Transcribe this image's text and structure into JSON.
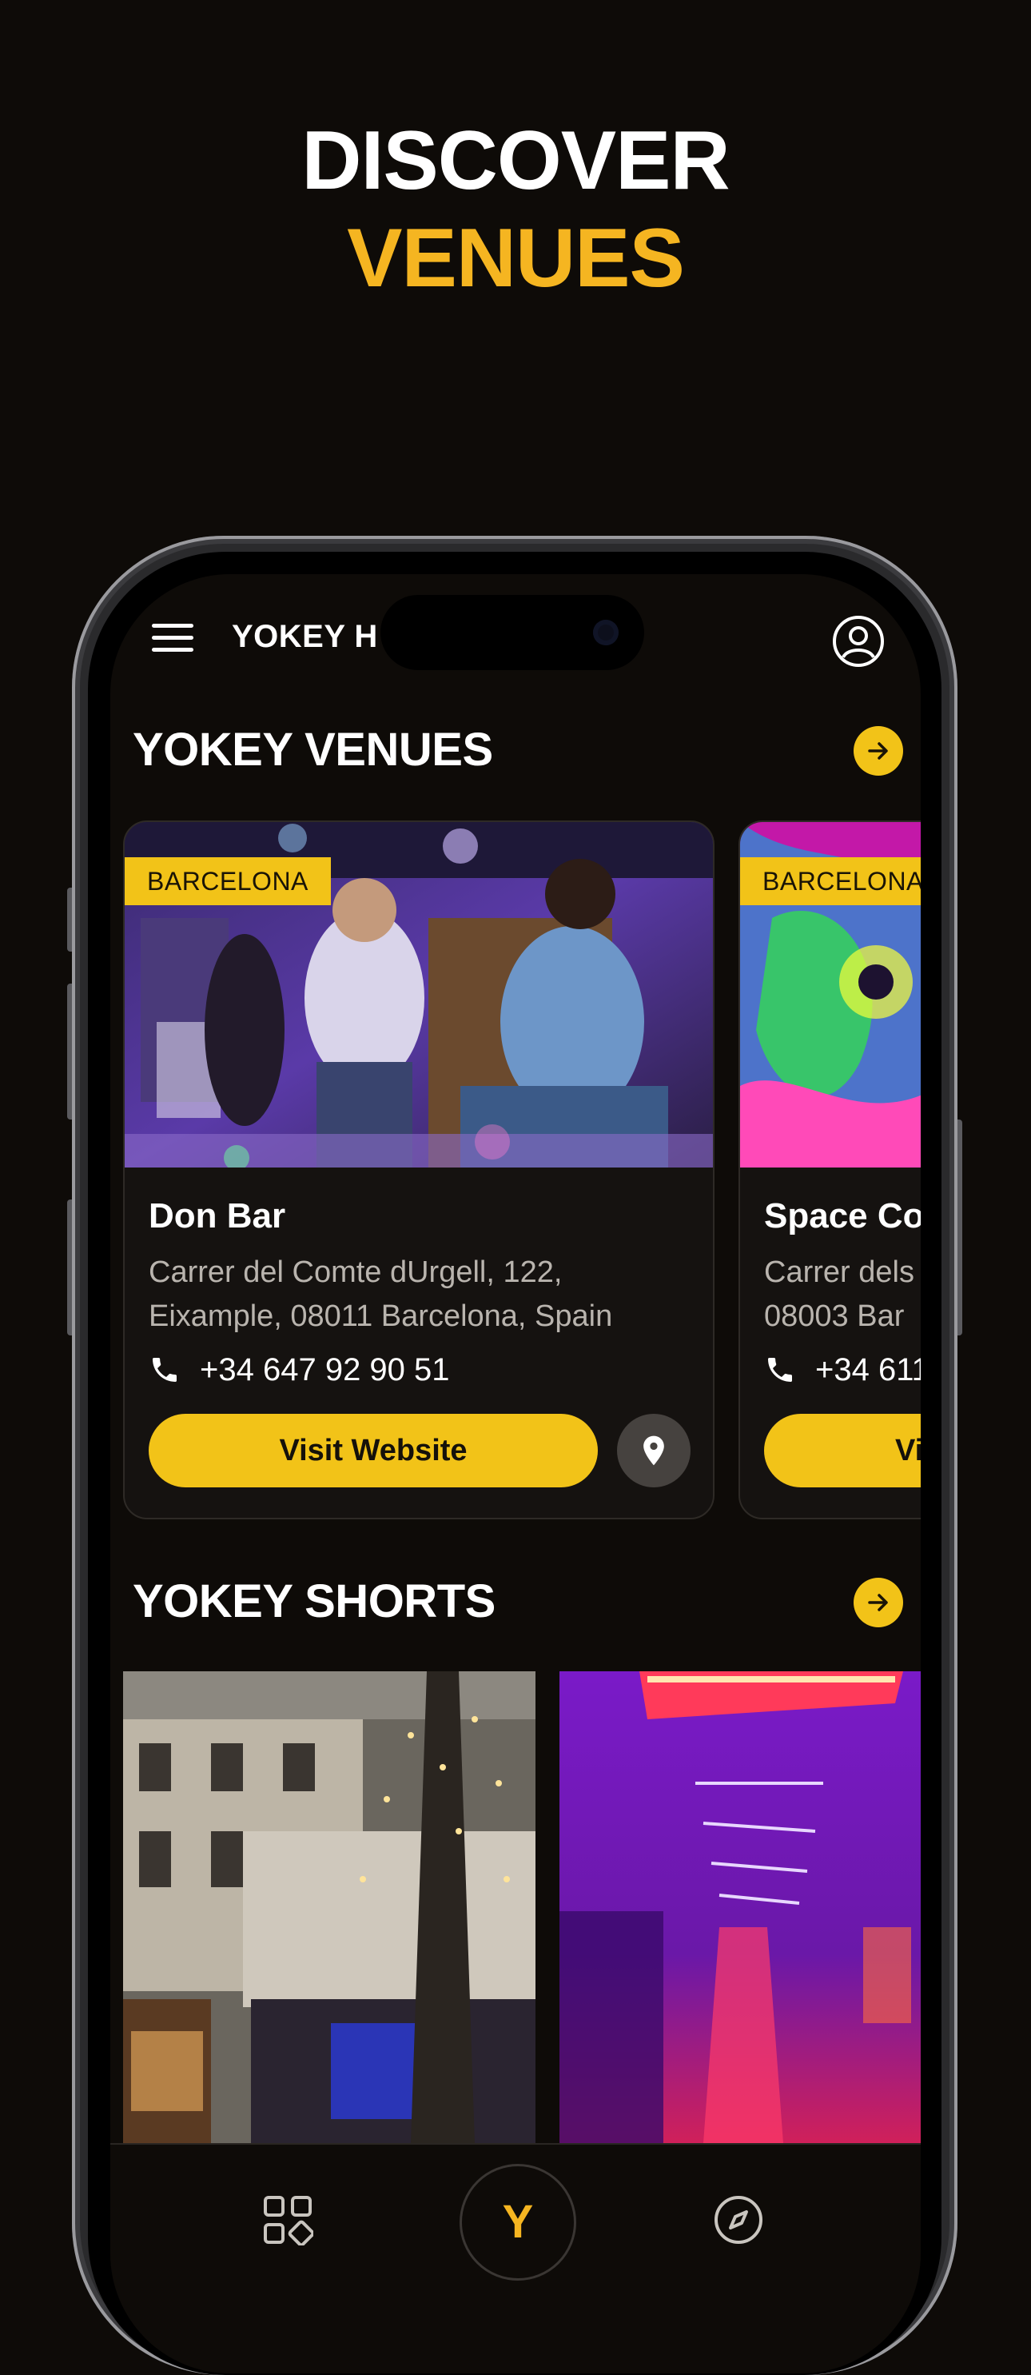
{
  "hero": {
    "line1": "DISCOVER",
    "line2": "VENUES"
  },
  "app": {
    "title": "YOKEY H",
    "menu_icon": "hamburger-menu-icon",
    "profile_icon": "user-circle-icon"
  },
  "sections": {
    "venues_title": "YOKEY VENUES",
    "shorts_title": "YOKEY SHORTS"
  },
  "venues": [
    {
      "tag": "BARCELONA",
      "name": "Don Bar",
      "address_line1": "Carrer del Comte dUrgell, 122,",
      "address_line2": "Eixample, 08011 Barcelona, Spain",
      "phone": "+34 647 92 90 51",
      "button": "Visit Website"
    },
    {
      "tag": "BARCELONA",
      "name": "Space Co",
      "address_line1": "Carrer dels",
      "address_line2": "08003 Bar",
      "phone": "+34 611",
      "button": "Vi"
    }
  ],
  "nav": {
    "center_label": "Y"
  },
  "colors": {
    "accent": "#f2c318",
    "hero_accent": "#f5b521",
    "background": "#0e0b08"
  }
}
